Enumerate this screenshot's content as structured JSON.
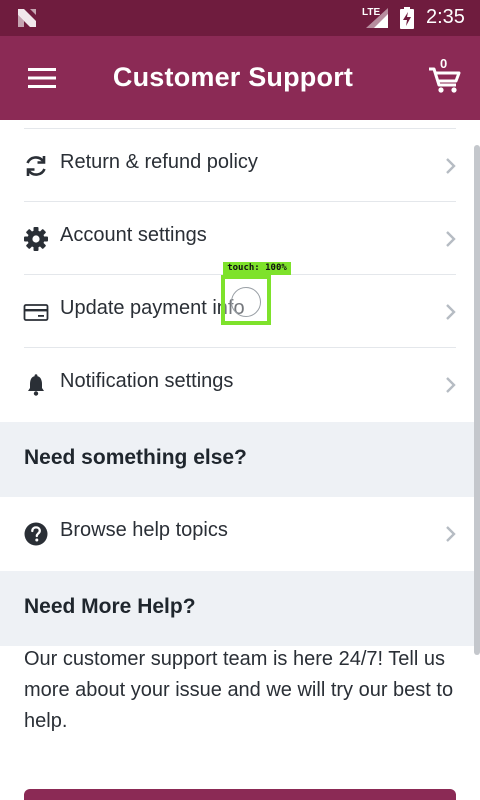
{
  "status_bar": {
    "network": "LTE",
    "time": "2:35"
  },
  "app_bar": {
    "title": "Customer Support",
    "cart_count": "0",
    "menu_icon": "hamburger-menu-icon",
    "cart_icon": "cart-icon"
  },
  "settings_list": [
    {
      "label": "Return & refund policy",
      "icon": "refresh-icon"
    },
    {
      "label": "Account settings",
      "icon": "gear-icon"
    },
    {
      "label": "Update payment info",
      "icon": "credit-card-icon"
    },
    {
      "label": "Notification settings",
      "icon": "bell-icon"
    }
  ],
  "section_else": {
    "title": "Need something else?",
    "items": [
      {
        "label": "Browse help topics",
        "icon": "help-circle-icon"
      }
    ]
  },
  "section_more_help": {
    "title": "Need More Help?",
    "body": "Our customer support team is here 24/7! Tell us more about your issue and we will try our best to help."
  },
  "touch_overlay": {
    "label": "touch: 100%"
  },
  "colors": {
    "status_bar": "#6f1c3e",
    "app_bar": "#8b2a55",
    "section_header_bg": "#eef1f5",
    "touch_highlight": "#7ee22b"
  }
}
